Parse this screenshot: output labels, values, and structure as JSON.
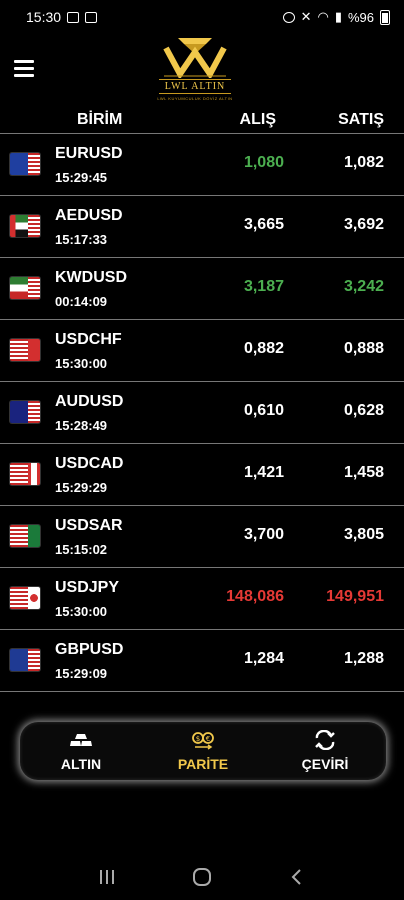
{
  "status_bar": {
    "time": "15:30",
    "battery": "%96"
  },
  "logo": {
    "name": "LWL ALTIN",
    "subtitle": "LWL KUYUMCULUK DÖVİZ ALTIN"
  },
  "colors": {
    "accent": "#f1c84b",
    "up": "#4caf50",
    "down": "#e53935",
    "neutral": "#ffffff"
  },
  "table": {
    "headers": {
      "unit": "BİRİM",
      "buy": "ALIŞ",
      "sell": "SATIŞ"
    },
    "rows": [
      {
        "symbol": "EURUSD",
        "time": "15:29:45",
        "buy": "1,080",
        "sell": "1,082",
        "buy_trend": "up",
        "sell_trend": "neutral",
        "flag": "eu-us"
      },
      {
        "symbol": "AEDUSD",
        "time": "15:17:33",
        "buy": "3,665",
        "sell": "3,692",
        "buy_trend": "neutral",
        "sell_trend": "neutral",
        "flag": "ae-us"
      },
      {
        "symbol": "KWDUSD",
        "time": "00:14:09",
        "buy": "3,187",
        "sell": "3,242",
        "buy_trend": "up",
        "sell_trend": "up",
        "flag": "kw-us"
      },
      {
        "symbol": "USDCHF",
        "time": "15:30:00",
        "buy": "0,882",
        "sell": "0,888",
        "buy_trend": "neutral",
        "sell_trend": "neutral",
        "flag": "us-ch"
      },
      {
        "symbol": "AUDUSD",
        "time": "15:28:49",
        "buy": "0,610",
        "sell": "0,628",
        "buy_trend": "neutral",
        "sell_trend": "neutral",
        "flag": "au-us"
      },
      {
        "symbol": "USDCAD",
        "time": "15:29:29",
        "buy": "1,421",
        "sell": "1,458",
        "buy_trend": "neutral",
        "sell_trend": "neutral",
        "flag": "us-ca"
      },
      {
        "symbol": "USDSAR",
        "time": "15:15:02",
        "buy": "3,700",
        "sell": "3,805",
        "buy_trend": "neutral",
        "sell_trend": "neutral",
        "flag": "us-sa"
      },
      {
        "symbol": "USDJPY",
        "time": "15:30:00",
        "buy": "148,086",
        "sell": "149,951",
        "buy_trend": "down",
        "sell_trend": "down",
        "flag": "us-jp"
      },
      {
        "symbol": "GBPUSD",
        "time": "15:29:09",
        "buy": "1,284",
        "sell": "1,288",
        "buy_trend": "neutral",
        "sell_trend": "neutral",
        "flag": "gb-us"
      }
    ]
  },
  "bottom_nav": [
    {
      "label": "ALTIN",
      "icon": "gold-bars-icon",
      "active": false
    },
    {
      "label": "PARİTE",
      "icon": "currency-exchange-icon",
      "active": true
    },
    {
      "label": "ÇEVİRİ",
      "icon": "swap-arrows-icon",
      "active": false
    }
  ]
}
